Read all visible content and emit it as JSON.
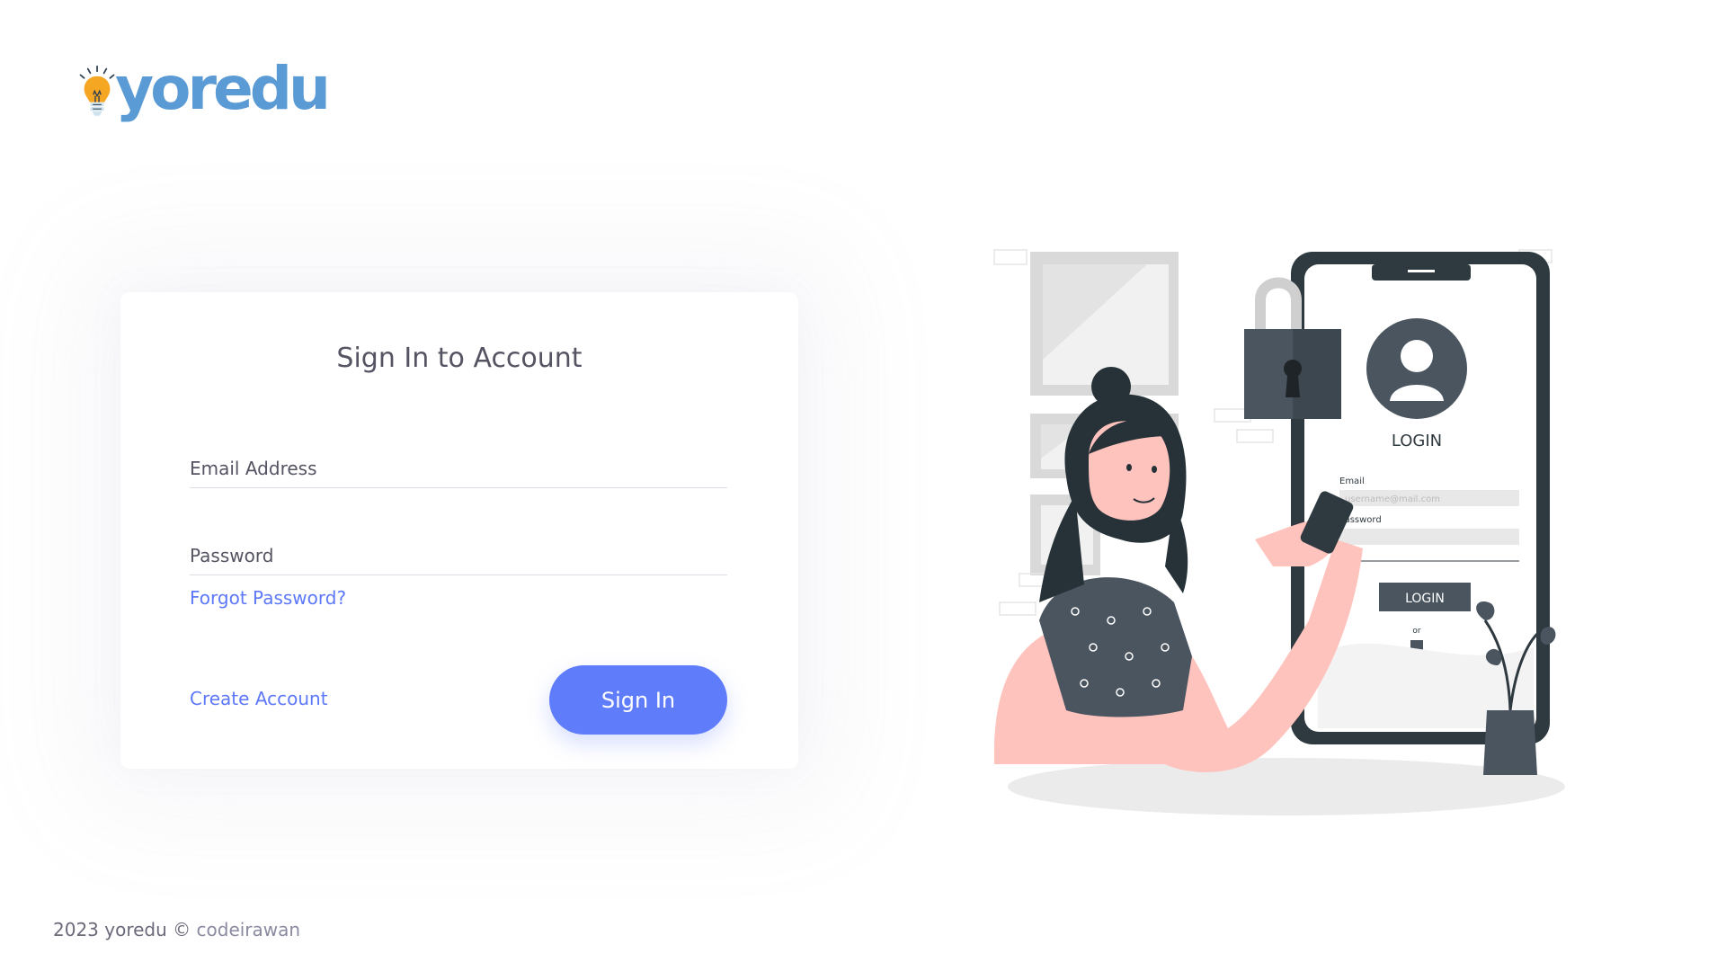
{
  "brand": {
    "name": "yoredu",
    "logo_icon": "lightbulb-icon",
    "color": "#5b9bd5",
    "bulb_color": "#f5a623"
  },
  "login_form": {
    "title": "Sign In to Account",
    "email_placeholder": "Email Address",
    "password_placeholder": "Password",
    "forgot_password": "Forgot Password?",
    "create_account": "Create Account",
    "sign_in_button": "Sign In",
    "accent_color": "#5f7dfb"
  },
  "illustration": {
    "phone_screen": {
      "title": "LOGIN",
      "email_label": "Email",
      "email_placeholder": "username@mail.com",
      "password_label": "Password",
      "login_button": "LOGIN",
      "or_text": "or"
    }
  },
  "footer": {
    "text": "2023 yoredu ©",
    "author": "codeirawan"
  }
}
